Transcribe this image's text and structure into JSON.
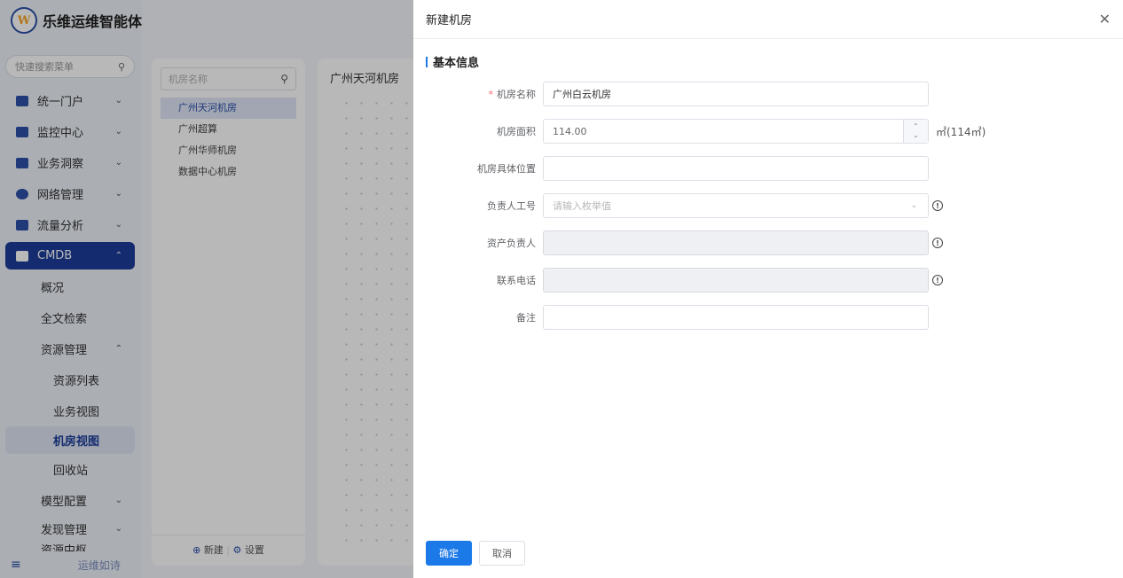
{
  "app": {
    "logo_text": "W",
    "name": "乐维运维智能体"
  },
  "sidebar": {
    "search_placeholder": "快速搜索菜单",
    "menus": [
      {
        "label": "统一门户",
        "icon": "home-icon"
      },
      {
        "label": "监控中心",
        "icon": "monitor-icon"
      },
      {
        "label": "业务洞察",
        "icon": "insight-icon"
      },
      {
        "label": "网络管理",
        "icon": "globe-icon"
      },
      {
        "label": "流量分析",
        "icon": "chart-icon"
      }
    ],
    "cmdb": {
      "label": "CMDB",
      "children": {
        "overview": "概况",
        "fulltext": "全文检索",
        "resource_mgmt": "资源管理",
        "resource_list": "资源列表",
        "business_view": "业务视图",
        "room_view": "机房视图",
        "recycle": "回收站",
        "model_config": "模型配置",
        "discovery": "发现管理",
        "partial": "资源中枢"
      }
    },
    "footer_slogan": "运维如诗"
  },
  "room_panel": {
    "search_placeholder": "机房名称",
    "rooms": [
      "广州天河机房",
      "广州超算",
      "广州华师机房",
      "数据中心机房"
    ],
    "new_label": "新建",
    "settings_label": "设置"
  },
  "canvas": {
    "title": "广州天河机房"
  },
  "drawer": {
    "title": "新建机房",
    "section_title": "基本信息",
    "fields": {
      "name": {
        "label": "机房名称",
        "value": "广州白云机房",
        "required": "*"
      },
      "area": {
        "label": "机房面积",
        "value": "114.00",
        "suffix": "㎡(114㎡)"
      },
      "location": {
        "label": "机房具体位置",
        "value": ""
      },
      "owner_id": {
        "label": "负责人工号",
        "placeholder": "请输入枚举值"
      },
      "asset_owner": {
        "label": "资产负责人",
        "value": ""
      },
      "phone": {
        "label": "联系电话",
        "value": ""
      },
      "remark": {
        "label": "备注",
        "value": ""
      }
    },
    "confirm_label": "确定",
    "cancel_label": "取消"
  }
}
